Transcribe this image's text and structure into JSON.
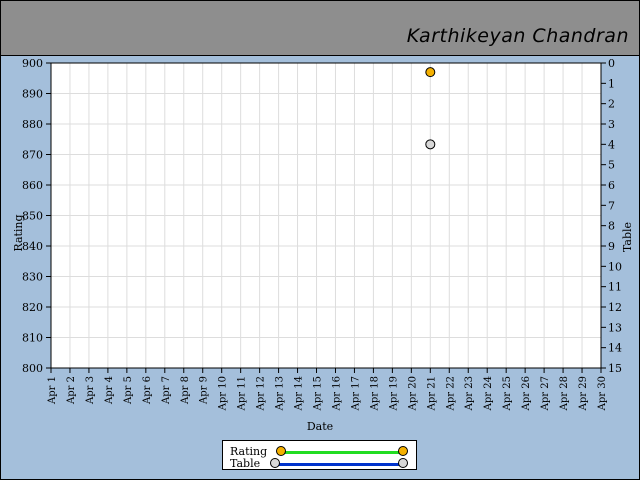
{
  "header": {
    "name": "Karthikeyan Chandran"
  },
  "colors": {
    "background": "#a4bfdb",
    "header": "#8e8e8e",
    "rating_line": "#22dd22",
    "rating_marker": "#f4b000",
    "table_line": "#0033cc",
    "table_marker": "#d8d8d8",
    "grid": "#dddddd"
  },
  "chart_data": {
    "type": "scatter",
    "x_categories": [
      "Apr 1",
      "Apr 2",
      "Apr 3",
      "Apr 4",
      "Apr 5",
      "Apr 6",
      "Apr 7",
      "Apr 8",
      "Apr 9",
      "Apr 10",
      "Apr 11",
      "Apr 12",
      "Apr 13",
      "Apr 14",
      "Apr 15",
      "Apr 16",
      "Apr 17",
      "Apr 18",
      "Apr 19",
      "Apr 20",
      "Apr 21",
      "Apr 22",
      "Apr 23",
      "Apr 24",
      "Apr 25",
      "Apr 26",
      "Apr 27",
      "Apr 28",
      "Apr 29",
      "Apr 30"
    ],
    "xlabel": "Date",
    "ylabel": "Rating",
    "y2label": "Table",
    "ylim": [
      800,
      900
    ],
    "y_ticks": [
      800,
      810,
      820,
      830,
      840,
      850,
      860,
      870,
      880,
      890,
      900
    ],
    "y2lim": [
      0,
      15
    ],
    "y2_inverted": true,
    "y2_ticks": [
      0,
      1,
      2,
      3,
      4,
      5,
      6,
      7,
      8,
      9,
      10,
      11,
      12,
      13,
      14,
      15
    ],
    "grid": true,
    "legend_position": "bottom-center",
    "series": [
      {
        "name": "Rating",
        "axis": "left",
        "points": [
          {
            "x": "Apr 21",
            "y": 897
          }
        ]
      },
      {
        "name": "Table",
        "axis": "right",
        "points": [
          {
            "x": "Apr 21",
            "y": 4
          }
        ]
      }
    ]
  }
}
